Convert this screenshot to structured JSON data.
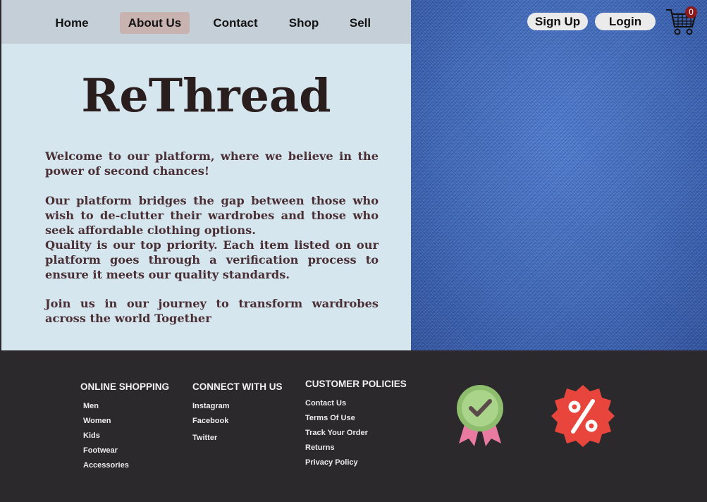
{
  "nav": {
    "items": [
      {
        "label": "Home"
      },
      {
        "label": "About Us"
      },
      {
        "label": "Contact"
      },
      {
        "label": "Shop"
      },
      {
        "label": "Sell"
      }
    ],
    "active": "About Us"
  },
  "auth": {
    "signup_label": "Sign Up",
    "login_label": "Login"
  },
  "cart": {
    "icon": "shopping-cart-icon",
    "count": "0"
  },
  "hero": {
    "brand": "ReThread",
    "paragraphs": [
      "Welcome to our platform, where we believe in the power of second chances!",
      "Our platform bridges the gap between those who wish to de-clutter their wardrobes and those who seek affordable clothing options.",
      "Quality is our top priority. Each item listed on our platform goes through a verification process to ensure it meets our quality standards.",
      "Join us in our journey to transform wardrobes across the world Together"
    ]
  },
  "footer": {
    "online_shopping": {
      "heading": "ONLINE SHOPPING",
      "links": [
        "Men",
        "Women",
        "Kids",
        "Footwear",
        "Accessories"
      ]
    },
    "connect": {
      "heading": "CONNECT WITH US",
      "links": [
        "Instagram",
        "Facebook",
        "Twitter"
      ]
    },
    "policies": {
      "heading": "CUSTOMER POLICIES",
      "links": [
        "Contact Us",
        "Terms Of Use",
        "Track Your Order",
        "Returns",
        "Privacy Policy"
      ]
    },
    "badges": [
      "quality-ribbon-icon",
      "discount-percent-icon"
    ]
  },
  "colors": {
    "left_panel": "#d6e6ef",
    "navbar": "#c4cfd7",
    "active_tab": "#c9b3b0",
    "denim": "#3a64b6",
    "footer": "#2b292c",
    "discount_badge": "#e8453c",
    "ribbon_green": "#9ecb7d",
    "ribbon_pink": "#e97aa0"
  }
}
